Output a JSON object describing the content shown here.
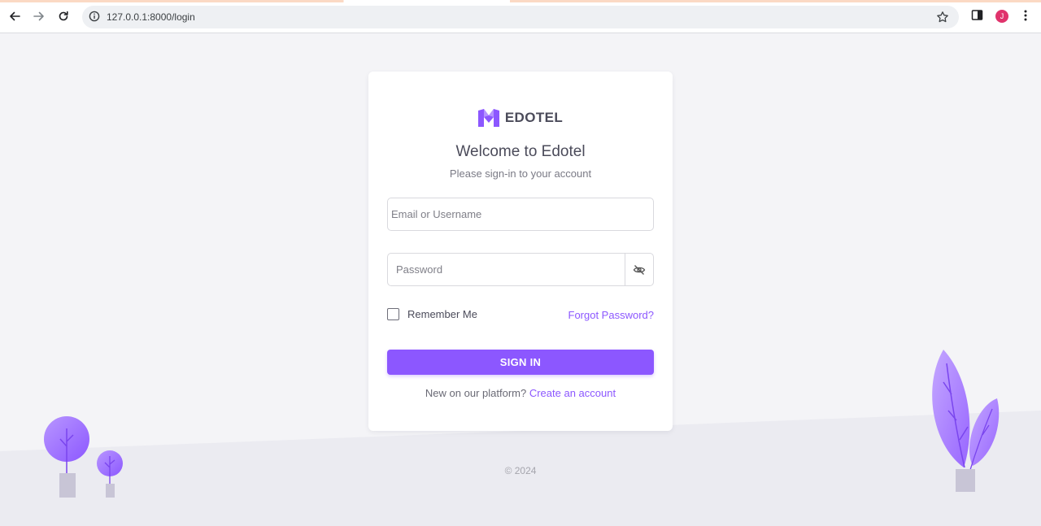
{
  "browser": {
    "url": "127.0.0.1:8000/login",
    "profile_initial": "J",
    "icons": [
      "back-arrow-icon",
      "forward-arrow-icon",
      "reload-icon",
      "site-info-icon",
      "bookmark-star-icon",
      "side-panel-icon",
      "kebab-menu-icon"
    ]
  },
  "login": {
    "brand_name": "EDOTEL",
    "welcome": "Welcome to Edotel",
    "subtitle": "Please sign-in to your account",
    "email_placeholder": "Email or Username",
    "email_value": "",
    "password_placeholder": "Password",
    "password_value": "",
    "remember_label": "Remember Me",
    "remember_checked": false,
    "forgot_label": "Forgot Password?",
    "signin_label": "SIGN IN",
    "new_text": "New on our platform?",
    "create_label": "Create an account"
  },
  "footer": {
    "copyright": "© 2024"
  },
  "colors": {
    "primary": "#8c57ff",
    "background": "#f4f4f7",
    "ground": "#ebebf1",
    "pot": "#c8c5d6"
  }
}
